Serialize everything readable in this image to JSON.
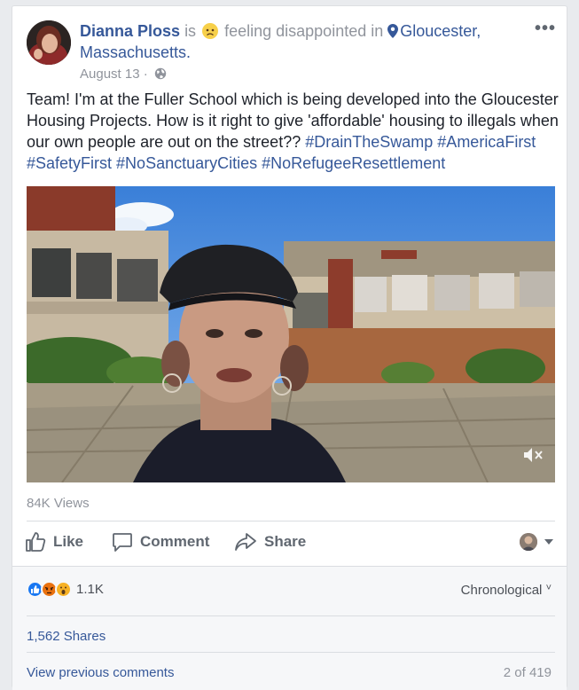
{
  "post": {
    "author": "Dianna Ploss",
    "is_word": "is",
    "feeling": "feeling disappointed in",
    "location_line1": "Gloucester,",
    "location_line2": "Massachusetts.",
    "date": "August 13",
    "date_sep": "·",
    "more": "•••",
    "text": "Team! I'm at the Fuller School which is being developed into the Gloucester Housing Projects. How is it right to give 'affordable' housing to illegals when our own people are out on the street?? ",
    "hashtags": [
      "#DrainTheSwamp",
      "#AmericaFirst",
      "#SafetyFirst",
      "#NoSanctuaryCities",
      "#NoRefugeeResettlement"
    ],
    "views": "84K Views"
  },
  "actions": {
    "like": "Like",
    "comment": "Comment",
    "share": "Share"
  },
  "footer": {
    "reaction_count": "1.1K",
    "sort": "Chronological",
    "sort_caret": "˅",
    "shares": "1,562 Shares",
    "view_previous": "View previous comments",
    "comment_count": "2 of 419"
  },
  "icons": {
    "feeling": "disappointed-face-icon",
    "location": "location-pin-icon",
    "privacy": "globe-icon",
    "video_audio": "muted-speaker-icon",
    "like": "thumbs-up-icon",
    "comment": "speech-bubble-icon",
    "share": "share-arrow-icon"
  },
  "colors": {
    "link": "#365899",
    "meta": "#90949c",
    "text": "#1d2129",
    "action": "#606770",
    "like_reaction": "#1877f2",
    "angry_reaction": "#e9710f",
    "wow_reaction": "#f7b125"
  }
}
